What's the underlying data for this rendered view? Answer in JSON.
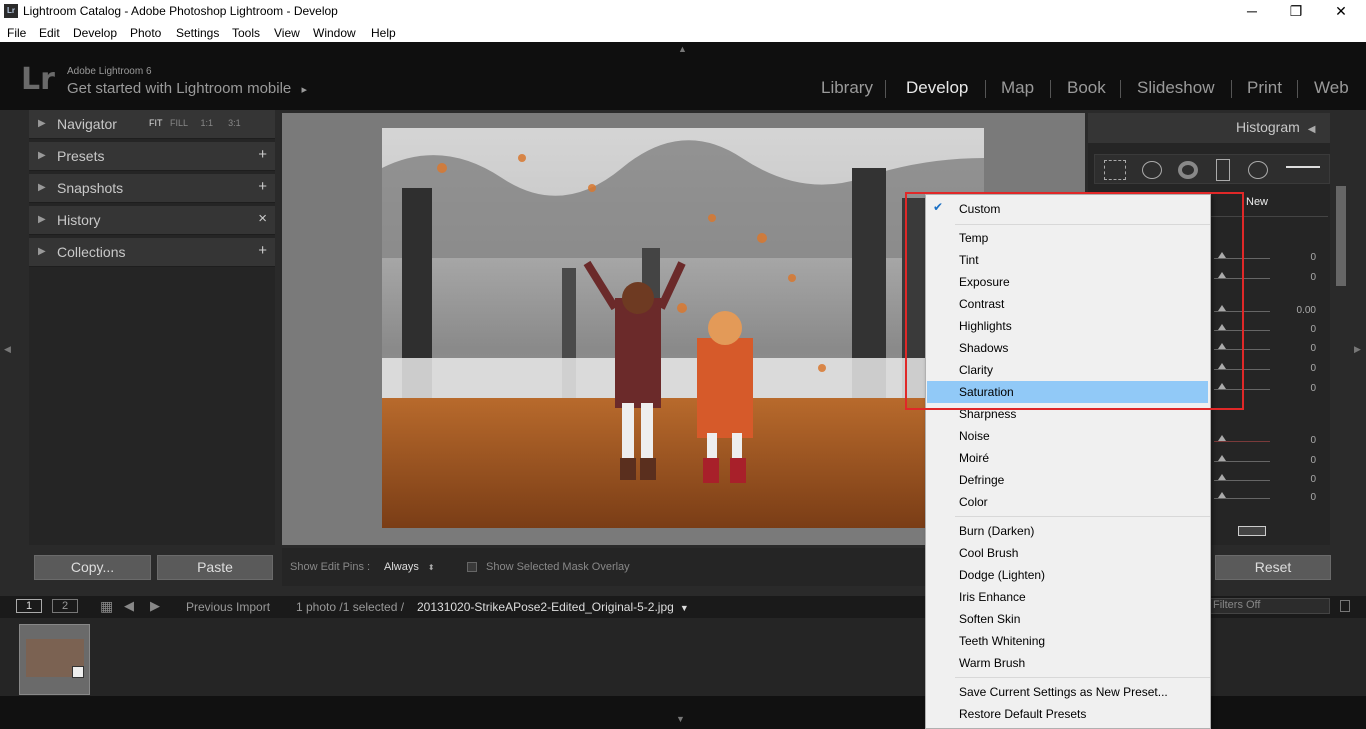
{
  "window": {
    "title": "Lightroom Catalog - Adobe Photoshop Lightroom - Develop",
    "app_icon": "Lr",
    "minimize": "─",
    "maximize": "❐",
    "close": "✕"
  },
  "menu": [
    "File",
    "Edit",
    "Develop",
    "Photo",
    "Settings",
    "Tools",
    "View",
    "Window",
    "Help"
  ],
  "identity": {
    "logo": "Lr",
    "product": "Adobe Lightroom 6",
    "tagline": "Get started with Lightroom mobile",
    "tagline_arrow": "▸"
  },
  "modules": [
    "Library",
    "Develop",
    "Map",
    "Book",
    "Slideshow",
    "Print",
    "Web"
  ],
  "active_module": "Develop",
  "left_panel": {
    "navigator": {
      "label": "Navigator",
      "zoom": [
        "FIT",
        "FILL",
        "1:1",
        "3:1"
      ]
    },
    "sections": [
      {
        "label": "Presets",
        "action": "+"
      },
      {
        "label": "Snapshots",
        "action": "+"
      },
      {
        "label": "History",
        "action": "×"
      },
      {
        "label": "Collections",
        "action": "+"
      }
    ],
    "copy_button": "Copy...",
    "paste_button": "Paste"
  },
  "toolbar": {
    "edit_pins_label": "Show Edit Pins :",
    "edit_pins_value": "Always",
    "mask_overlay_label": "Show Selected Mask Overlay"
  },
  "right_panel": {
    "histogram_label": "Histogram",
    "mask_new": "New",
    "slider_values": [
      "0",
      "0",
      "0.00",
      "0",
      "0",
      "0",
      "0",
      "0",
      "0",
      "0",
      "0",
      "0"
    ],
    "reset_button": "Reset"
  },
  "filmstrip": {
    "view1": "1",
    "view2": "2",
    "source": "Previous Import",
    "count": "1 photo /1 selected /",
    "filename": "20131020-StrikeAPose2-Edited_Original-5-2.jpg",
    "filters": "Filters Off"
  },
  "effect_menu": {
    "checked_item": "Custom",
    "group1": [
      "Temp",
      "Tint",
      "Exposure",
      "Contrast",
      "Highlights",
      "Shadows",
      "Clarity",
      "Saturation",
      "Sharpness",
      "Noise",
      "Moiré",
      "Defringe",
      "Color"
    ],
    "group2": [
      "Burn (Darken)",
      "Cool Brush",
      "Dodge (Lighten)",
      "Iris Enhance",
      "Soften Skin",
      "Teeth Whitening",
      "Warm Brush"
    ],
    "group3": [
      "Save Current Settings as New Preset...",
      "Restore Default Presets"
    ],
    "highlighted": "Saturation",
    "check_icon": "✔"
  },
  "colors": {
    "highlight": "#91c9f7",
    "annotation_box": "#e02828",
    "accent_orange": "#d9782f"
  }
}
